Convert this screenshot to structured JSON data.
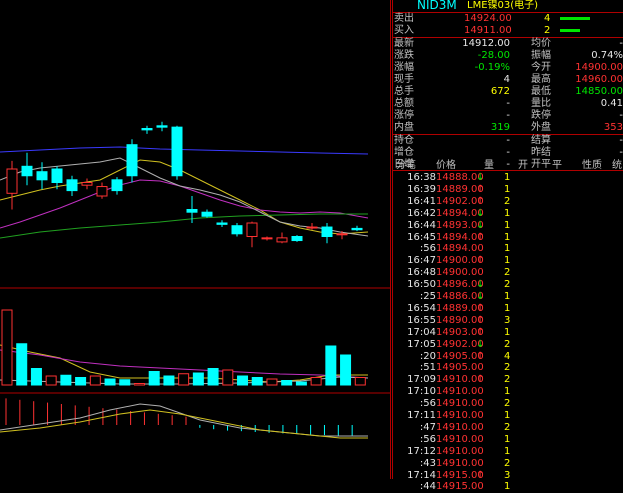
{
  "title": {
    "code": "NID3M",
    "name": "LME镍03(电子)"
  },
  "quote": {
    "sell": {
      "label": "卖出",
      "price": "14924.00",
      "qty": "4"
    },
    "buy": {
      "label": "买入",
      "price": "14911.00",
      "qty": "2"
    },
    "left": [
      {
        "label": "最新",
        "value": "14912.00",
        "color": "wht"
      },
      {
        "label": "涨跌",
        "value": "-28.00",
        "color": "green"
      },
      {
        "label": "涨幅",
        "value": "-0.19%",
        "color": "green"
      },
      {
        "label": "现手",
        "value": "4",
        "color": "wht"
      },
      {
        "label": "总手",
        "value": "672",
        "color": "yel"
      },
      {
        "label": "总额",
        "value": "-",
        "color": "wht"
      },
      {
        "label": "涨停",
        "value": "-",
        "color": "wht"
      },
      {
        "label": "内盘",
        "value": "319",
        "color": "green"
      }
    ],
    "right": [
      {
        "label": "均价",
        "value": "-",
        "color": "wht"
      },
      {
        "label": "振幅",
        "value": "0.74%",
        "color": "wht"
      },
      {
        "label": "今开",
        "value": "14900.00",
        "color": "red"
      },
      {
        "label": "最高",
        "value": "14960.00",
        "color": "red"
      },
      {
        "label": "最低",
        "value": "14850.00",
        "color": "green"
      },
      {
        "label": "量比",
        "value": "0.41",
        "color": "wht"
      },
      {
        "label": "跌停",
        "value": "-",
        "color": "wht"
      },
      {
        "label": "外盘",
        "value": "353",
        "color": "red"
      }
    ],
    "position": [
      {
        "label": "持仓",
        "value": "-",
        "label2": "结算",
        "value2": "-"
      },
      {
        "label": "增仓",
        "value": "-",
        "label2": "昨结",
        "value2": "-"
      },
      {
        "label": "日增",
        "value": "-",
        "label2": "开平",
        "value2": ""
      }
    ]
  },
  "ticks_header": {
    "time": "分笔",
    "price": "价格",
    "vol": "量",
    "open": "开",
    "close": "平",
    "nature": "性质",
    "more": "统"
  },
  "ticks": [
    {
      "time": "16:38",
      "price": "14888.00",
      "dir": "down",
      "vol": "1"
    },
    {
      "time": "16:39",
      "price": "14889.00",
      "dir": "up",
      "vol": "1"
    },
    {
      "time": "16:41",
      "price": "14902.00",
      "dir": "up",
      "vol": "2"
    },
    {
      "time": "16:42",
      "price": "14894.00",
      "dir": "down",
      "vol": "1"
    },
    {
      "time": "16:44",
      "price": "14893.00",
      "dir": "down",
      "vol": "1"
    },
    {
      "time": "16:45",
      "price": "14894.00",
      "dir": "up",
      "vol": "1"
    },
    {
      "time": ":56",
      "price": "14894.00",
      "dir": "",
      "vol": "1"
    },
    {
      "time": "16:47",
      "price": "14900.00",
      "dir": "up",
      "vol": "1"
    },
    {
      "time": "16:48",
      "price": "14900.00",
      "dir": "",
      "vol": "2"
    },
    {
      "time": "16:50",
      "price": "14896.00",
      "dir": "down",
      "vol": "2"
    },
    {
      "time": ":25",
      "price": "14886.00",
      "dir": "down",
      "vol": "1"
    },
    {
      "time": "16:54",
      "price": "14889.00",
      "dir": "up",
      "vol": "1"
    },
    {
      "time": "16:55",
      "price": "14890.00",
      "dir": "up",
      "vol": "3"
    },
    {
      "time": "17:04",
      "price": "14903.00",
      "dir": "up",
      "vol": "1"
    },
    {
      "time": "17:05",
      "price": "14902.00",
      "dir": "down",
      "vol": "2"
    },
    {
      "time": ":20",
      "price": "14905.00",
      "dir": "up",
      "vol": "4"
    },
    {
      "time": ":51",
      "price": "14905.00",
      "dir": "",
      "vol": "2"
    },
    {
      "time": "17:09",
      "price": "14910.00",
      "dir": "up",
      "vol": "2"
    },
    {
      "time": "17:10",
      "price": "14910.00",
      "dir": "",
      "vol": "1"
    },
    {
      "time": ":56",
      "price": "14910.00",
      "dir": "",
      "vol": "2"
    },
    {
      "time": "17:11",
      "price": "14910.00",
      "dir": "",
      "vol": "1"
    },
    {
      "time": ":47",
      "price": "14910.00",
      "dir": "",
      "vol": "2"
    },
    {
      "time": ":56",
      "price": "14910.00",
      "dir": "",
      "vol": "1"
    },
    {
      "time": "17:12",
      "price": "14910.00",
      "dir": "",
      "vol": "1"
    },
    {
      "time": ":43",
      "price": "14910.00",
      "dir": "",
      "vol": "2"
    },
    {
      "time": "17:14",
      "price": "14915.00",
      "dir": "up",
      "vol": "3"
    },
    {
      "time": ":44",
      "price": "14915.00",
      "dir": "",
      "vol": "1"
    }
  ],
  "chart_data": {
    "type": "candlestick",
    "candles": [
      {
        "o": 0.42,
        "c": 0.6,
        "h": 0.66,
        "l": 0.3
      },
      {
        "o": 0.62,
        "c": 0.55,
        "h": 0.72,
        "l": 0.48
      },
      {
        "o": 0.58,
        "c": 0.52,
        "h": 0.65,
        "l": 0.45
      },
      {
        "o": 0.6,
        "c": 0.5,
        "h": 0.62,
        "l": 0.45
      },
      {
        "o": 0.52,
        "c": 0.44,
        "h": 0.55,
        "l": 0.4
      },
      {
        "o": 0.48,
        "c": 0.5,
        "h": 0.53,
        "l": 0.45
      },
      {
        "o": 0.4,
        "c": 0.47,
        "h": 0.5,
        "l": 0.38
      },
      {
        "o": 0.52,
        "c": 0.44,
        "h": 0.54,
        "l": 0.41
      },
      {
        "o": 0.78,
        "c": 0.55,
        "h": 0.82,
        "l": 0.5
      },
      {
        "o": 0.9,
        "c": 0.89,
        "h": 0.92,
        "l": 0.86
      },
      {
        "o": 0.92,
        "c": 0.91,
        "h": 0.95,
        "l": 0.88
      },
      {
        "o": 0.91,
        "c": 0.55,
        "h": 0.92,
        "l": 0.52
      },
      {
        "o": 0.3,
        "c": 0.28,
        "h": 0.4,
        "l": 0.2
      },
      {
        "o": 0.28,
        "c": 0.25,
        "h": 0.3,
        "l": 0.24
      },
      {
        "o": 0.2,
        "c": 0.19,
        "h": 0.22,
        "l": 0.17
      },
      {
        "o": 0.18,
        "c": 0.12,
        "h": 0.2,
        "l": 0.1
      },
      {
        "o": 0.1,
        "c": 0.2,
        "h": 0.21,
        "l": 0.02
      },
      {
        "o": 0.09,
        "c": 0.09,
        "h": 0.1,
        "l": 0.07
      },
      {
        "o": 0.06,
        "c": 0.09,
        "h": 0.13,
        "l": 0.05
      },
      {
        "o": 0.1,
        "c": 0.07,
        "h": 0.11,
        "l": 0.06
      },
      {
        "o": 0.17,
        "c": 0.17,
        "h": 0.2,
        "l": 0.15
      },
      {
        "o": 0.17,
        "c": 0.1,
        "h": 0.2,
        "l": 0.05
      },
      {
        "o": 0.12,
        "c": 0.12,
        "h": 0.14,
        "l": 0.08
      },
      {
        "o": 0.16,
        "c": 0.15,
        "h": 0.18,
        "l": 0.14
      }
    ],
    "volume": [
      1.0,
      0.55,
      0.22,
      0.12,
      0.13,
      0.1,
      0.12,
      0.08,
      0.07,
      0.02,
      0.18,
      0.12,
      0.15,
      0.16,
      0.22,
      0.2,
      0.12,
      0.1,
      0.08,
      0.06,
      0.04,
      0.1,
      0.52,
      0.4,
      0.1
    ],
    "macd": [
      0.95,
      0.9,
      0.85,
      0.8,
      0.75,
      0.7,
      0.65,
      0.6,
      0.55,
      0.5,
      0.45,
      0.4,
      0.35,
      0.3,
      -0.1,
      -0.15,
      -0.2,
      -0.22,
      -0.25,
      -0.28,
      -0.3,
      -0.32,
      -0.35,
      -0.36,
      -0.38,
      -0.4
    ]
  }
}
